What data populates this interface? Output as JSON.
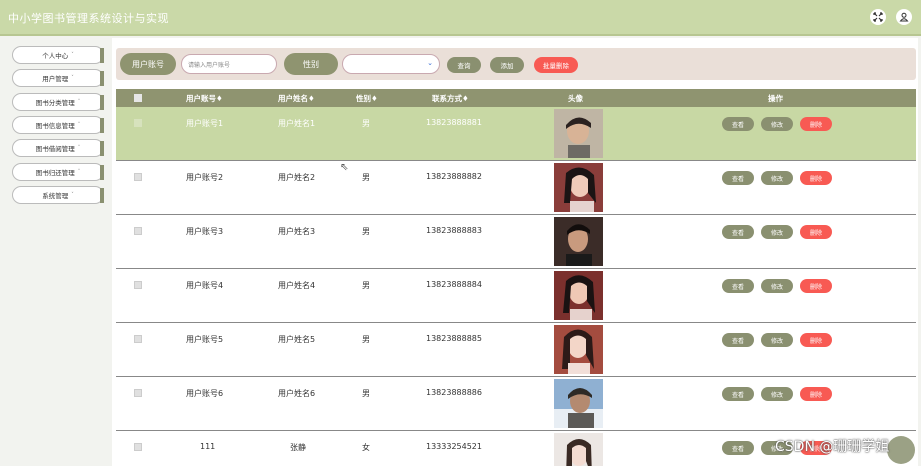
{
  "app": {
    "title": "中小学图书管理系统设计与实现"
  },
  "header": {
    "icons": [
      "fullscreen-icon",
      "user-icon"
    ]
  },
  "sidebar": {
    "items": [
      {
        "label": "个人中心"
      },
      {
        "label": "用户管理"
      },
      {
        "label": "图书分类管理"
      },
      {
        "label": "图书信息管理"
      },
      {
        "label": "图书借阅管理"
      },
      {
        "label": "图书归还管理"
      },
      {
        "label": "系统管理"
      }
    ],
    "chevron": "˅"
  },
  "filter": {
    "account_label": "用户账号",
    "account_placeholder": "请输入用户账号",
    "gender_label": "性别",
    "select_value": "",
    "select_chevron": "⌄",
    "search_button": "查询",
    "add_button": "添加",
    "bulk_delete_button": "批量删除"
  },
  "table": {
    "headers": {
      "account": "用户账号♦",
      "name": "用户姓名♦",
      "gender": "性别♦",
      "phone": "联系方式♦",
      "avatar": "头像",
      "actions": "操作"
    },
    "actions": {
      "view": "查看",
      "edit": "修改",
      "delete": "删除"
    },
    "rows": [
      {
        "account": "用户账号1",
        "name": "用户姓名1",
        "gender": "男",
        "phone": "13823888881"
      },
      {
        "account": "用户账号2",
        "name": "用户姓名2",
        "gender": "男",
        "phone": "13823888882"
      },
      {
        "account": "用户账号3",
        "name": "用户姓名3",
        "gender": "男",
        "phone": "13823888883"
      },
      {
        "account": "用户账号4",
        "name": "用户姓名4",
        "gender": "男",
        "phone": "13823888884"
      },
      {
        "account": "用户账号5",
        "name": "用户姓名5",
        "gender": "男",
        "phone": "13823888885"
      },
      {
        "account": "用户账号6",
        "name": "用户姓名6",
        "gender": "男",
        "phone": "13823888886"
      },
      {
        "account": "111",
        "name": "张静",
        "gender": "女",
        "phone": "13333254521"
      }
    ]
  },
  "watermark": "CSDN @珊珊学姐",
  "colors": {
    "header": "#cad9a8",
    "olive": "#8f9470",
    "danger": "#f85a53",
    "highlight": "#c8d8a4"
  }
}
